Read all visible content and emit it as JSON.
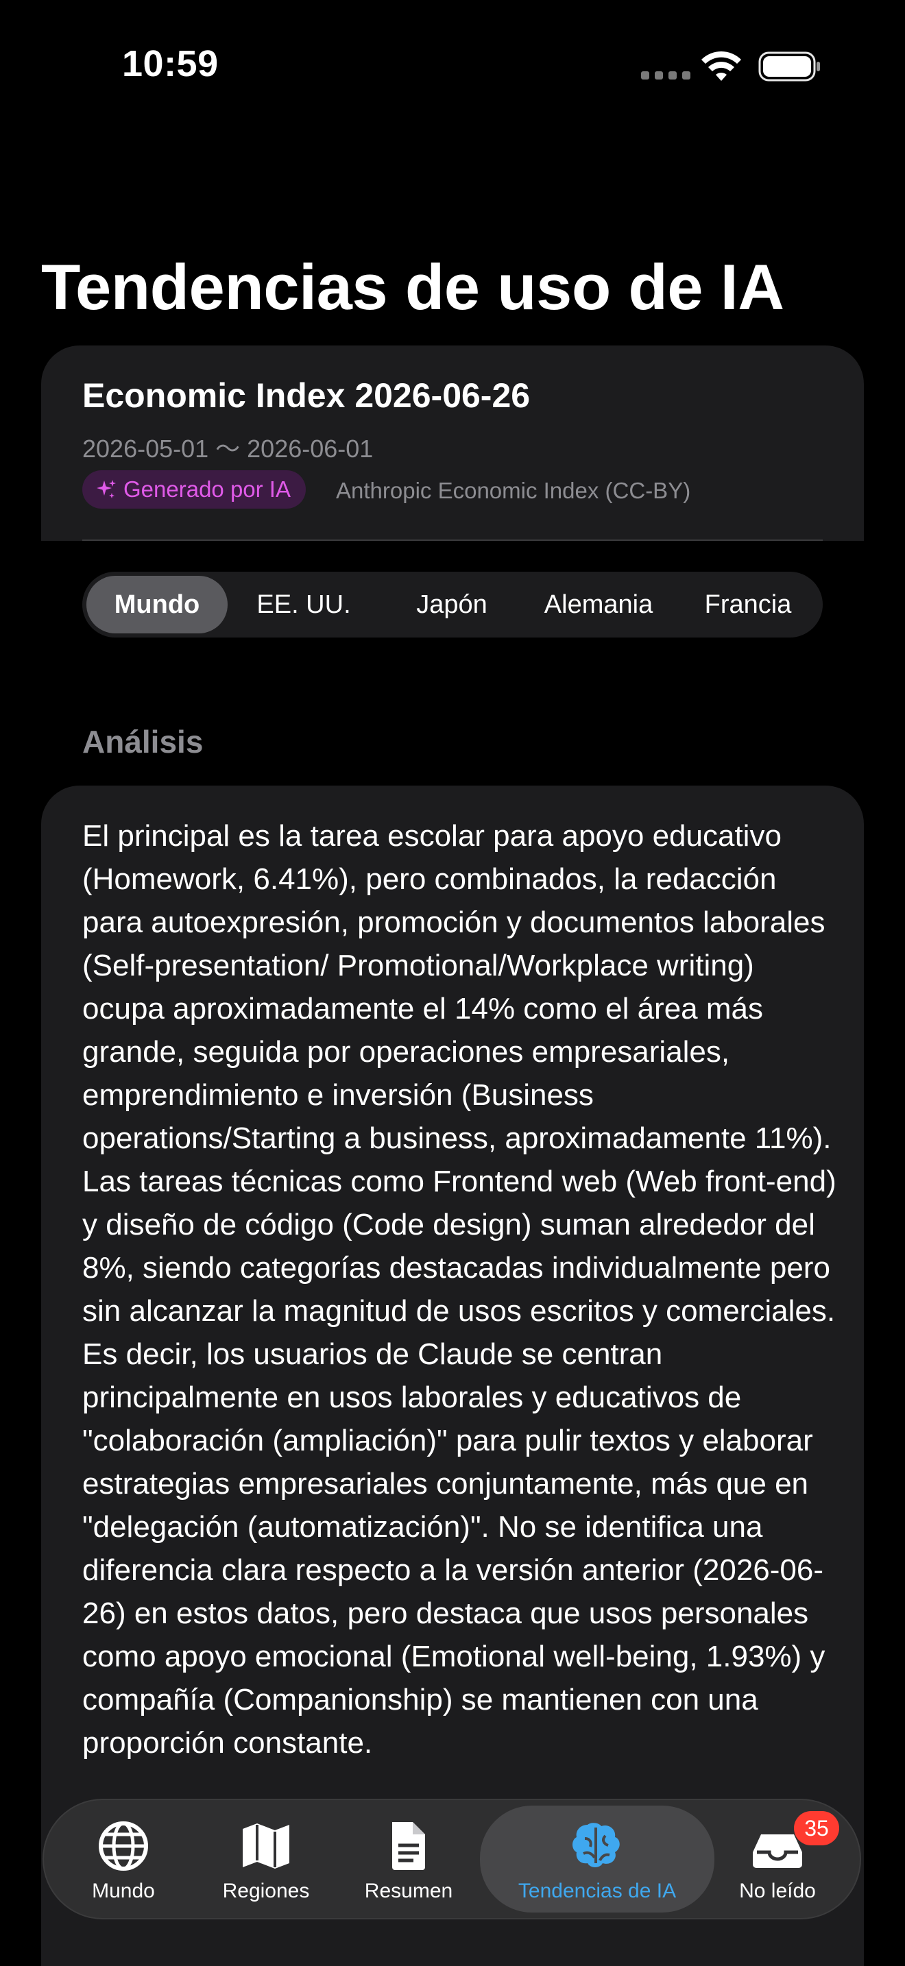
{
  "status_bar": {
    "time": "10:59"
  },
  "page": {
    "title": "Tendencias de uso de IA"
  },
  "report": {
    "title": "Economic Index 2026-06-26",
    "date_range": "2026-05-01 〜 2026-06-01",
    "ai_badge": "Generado por IA",
    "source": "Anthropic Economic Index (CC-BY)"
  },
  "regions": {
    "selected": "Mundo",
    "options": [
      "Mundo",
      "EE. UU.",
      "Japón",
      "Alemania",
      "Francia"
    ]
  },
  "analysis": {
    "header": "Análisis",
    "body": "El principal es la tarea escolar para apoyo educativo (Homework, 6.41%), pero combinados, la redacción para autoexpresión, promoción y documentos laborales (Self-presentation/ Promotional/Workplace writing) ocupa aproximadamente el 14% como el área más grande, seguida por operaciones empresariales, emprendimiento e inversión (Business operations/Starting a business, aproximadamente 11%). Las tareas técnicas como Frontend web (Web front-end) y diseño de código (Code design) suman alrededor del 8%, siendo categorías destacadas individualmente pero sin alcanzar la magnitud de usos escritos y comerciales. Es decir, los usuarios de Claude se centran principalmente en usos laborales y educativos de \"colaboración (ampliación)\" para pulir textos y elaborar estrategias empresariales conjuntamente, más que en \"delegación (automatización)\". No se identifica una diferencia clara respecto a la versión anterior (2026-06-26) en estos datos, pero destaca que usos personales como apoyo emocional (Emotional well-being, 1.93%) y compañía (Companionship) se mantienen con una proporción constante."
  },
  "tab_bar": {
    "tabs": [
      {
        "label": "Mundo",
        "icon": "globe-icon"
      },
      {
        "label": "Regiones",
        "icon": "map-icon"
      },
      {
        "label": "Resumen",
        "icon": "document-icon"
      },
      {
        "label": "Tendencias de IA",
        "icon": "brain-icon"
      },
      {
        "label": "No leído",
        "icon": "inbox-icon"
      }
    ],
    "selected": "Tendencias de IA",
    "unread_count": "35"
  },
  "colors": {
    "background": "#000000",
    "card": "#1c1c1e",
    "accent_blue": "#3fa8ef",
    "ai_magenta": "#e05ae8",
    "badge_red": "#ff3b30",
    "secondary_text": "#8d8d92"
  }
}
